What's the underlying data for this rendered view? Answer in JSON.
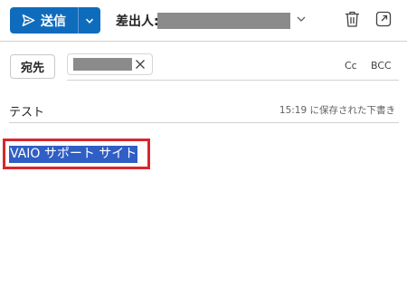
{
  "toolbar": {
    "send_label": "送信",
    "from_label": "差出人:",
    "icons": {
      "send": "send-icon",
      "dropdown": "chevron-down-icon",
      "delete": "trash-icon",
      "popout": "popout-icon"
    }
  },
  "recipients": {
    "to_label": "宛先",
    "cc_label": "Cc",
    "bcc_label": "BCC"
  },
  "subject": {
    "value": "テスト",
    "draft_status": "15:19 に保存された下書き"
  },
  "body": {
    "selected_text": "VAIO サポート サイト"
  },
  "colors": {
    "accent": "#0f6cbd",
    "selection": "#2f5ec5",
    "highlight_border": "#d9262c",
    "redacted": "#8b8b8b"
  }
}
